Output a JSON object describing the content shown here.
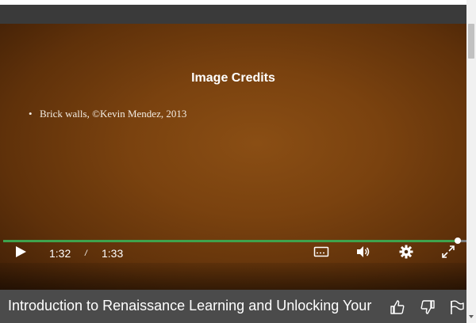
{
  "slide": {
    "title": "Image Credits",
    "bullets": [
      "Brick walls, ©Kevin Mendez, 2013"
    ]
  },
  "player": {
    "current_time": "1:32",
    "separator": "/",
    "duration": "1:33",
    "progress_fraction": 0.982,
    "progress_color": "#3fa34d",
    "icons": [
      "play-icon",
      "captions-icon",
      "volume-icon",
      "settings-icon",
      "fullscreen-icon"
    ]
  },
  "video": {
    "title": "Introduction to Renaissance Learning and Unlocking Your",
    "actions": [
      "thumbs-up-icon",
      "thumbs-down-icon",
      "flag-icon"
    ]
  }
}
